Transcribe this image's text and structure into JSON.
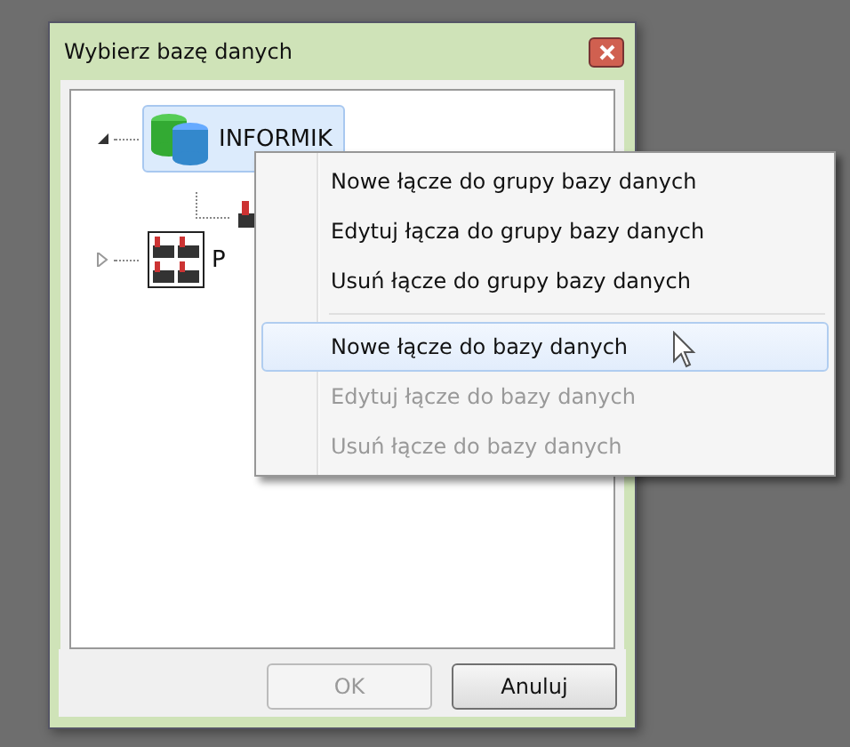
{
  "window": {
    "title": "Wybierz bazę danych"
  },
  "tree": [
    {
      "kind": "group",
      "label": "INFORMIK",
      "expanded": true,
      "selected": true,
      "children": [
        {
          "kind": "database"
        }
      ]
    },
    {
      "kind": "database-set",
      "label": "P",
      "expanded": false,
      "selected": false
    }
  ],
  "context_menu": [
    {
      "kind": "item",
      "label": "Nowe łącze do grupy bazy danych",
      "disabled": false,
      "selected": false
    },
    {
      "kind": "item",
      "label": "Edytuj łącza do grupy bazy danych",
      "disabled": false,
      "selected": false
    },
    {
      "kind": "item",
      "label": "Usuń łącze do grupy bazy danych",
      "disabled": false,
      "selected": false
    },
    {
      "kind": "separator"
    },
    {
      "kind": "item",
      "label": "Nowe łącze do bazy danych",
      "disabled": false,
      "selected": true
    },
    {
      "kind": "item",
      "label": "Edytuj łącze do bazy danych",
      "disabled": true,
      "selected": false
    },
    {
      "kind": "item",
      "label": "Usuń łącze do bazy danych",
      "disabled": true,
      "selected": false
    }
  ],
  "buttons": [
    {
      "label": "OK",
      "disabled": true
    },
    {
      "label": "Anuluj",
      "disabled": false
    }
  ]
}
